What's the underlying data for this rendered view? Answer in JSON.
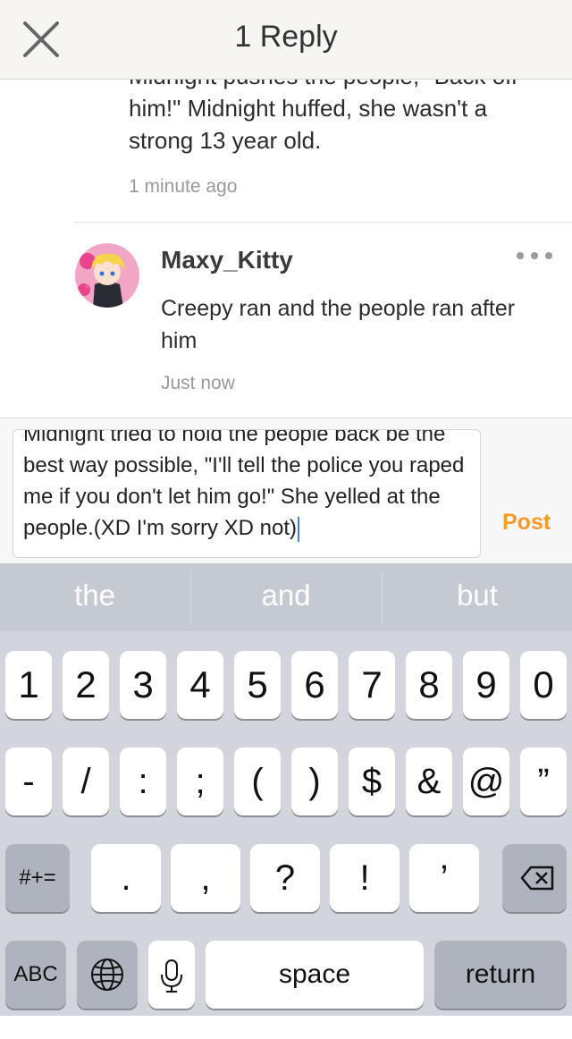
{
  "header": {
    "title": "1 Reply",
    "close_icon": "close-icon"
  },
  "previous_comment": {
    "text": "Midnight pushes the people, \"Back off him!\" Midnight huffed, she wasn't a strong 13 year old.",
    "time": "1 minute ago"
  },
  "reply": {
    "username": "Maxy_Kitty",
    "text": "Creepy ran and the people ran after him",
    "time": "Just now",
    "more_icon": "more-dots-icon"
  },
  "composer": {
    "text": "Midnight tried to hold the people back be the best way possible, \"I'll tell the police you raped me if you don't let him go!\" She yelled at the people.(XD I'm sorry XD not)",
    "post_label": "Post",
    "accent": "#f49b28"
  },
  "keyboard": {
    "suggestions": [
      "the",
      "and",
      "but"
    ],
    "row1": [
      "1",
      "2",
      "3",
      "4",
      "5",
      "6",
      "7",
      "8",
      "9",
      "0"
    ],
    "row2": [
      "-",
      "/",
      ":",
      ";",
      "(",
      ")",
      "$",
      "&",
      "@",
      "”"
    ],
    "row3": {
      "mode": "#+=",
      "keys": [
        ".",
        ",",
        "?",
        "!",
        "’"
      ],
      "delete_icon": "backspace-icon"
    },
    "row4": {
      "abc": "ABC",
      "globe_icon": "globe-icon",
      "mic_icon": "microphone-icon",
      "space": "space",
      "return": "return"
    }
  }
}
